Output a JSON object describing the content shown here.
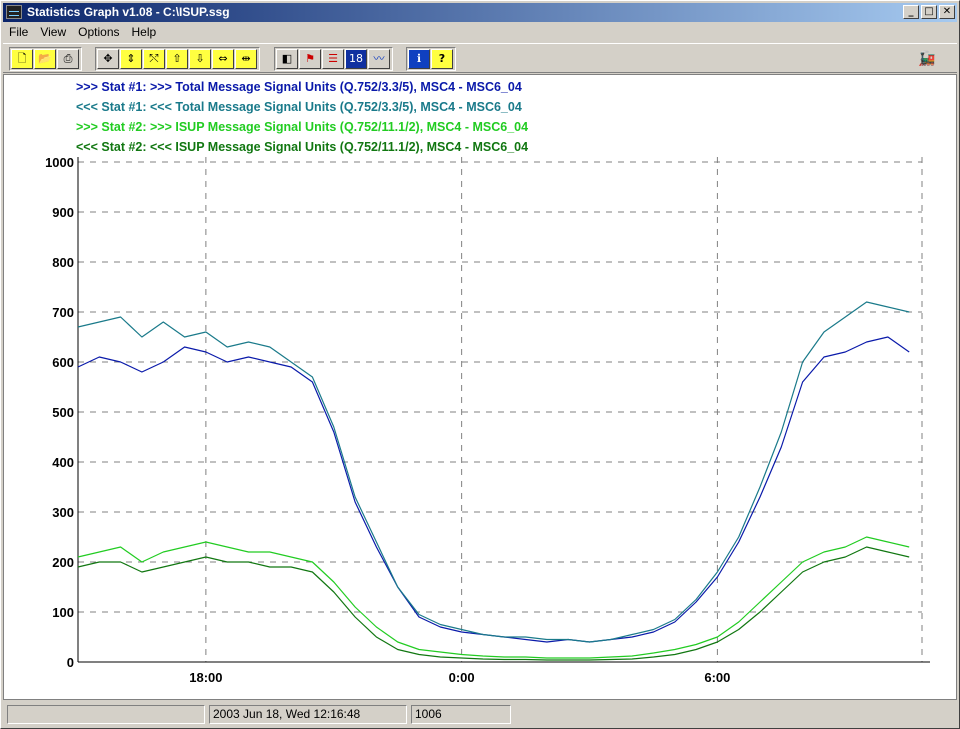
{
  "window": {
    "title": "Statistics Graph v1.08 - C:\\ISUP.ssg",
    "min_glyph": "_",
    "max_glyph": "□",
    "close_glyph": "✕"
  },
  "menu": [
    "File",
    "View",
    "Options",
    "Help"
  ],
  "toolbar": {
    "buttons": [
      {
        "name": "new-file",
        "icon": "new-file-icon",
        "glyph": "🗋"
      },
      {
        "name": "open-file",
        "icon": "open-folder-icon",
        "glyph": "📂"
      },
      {
        "name": "print",
        "icon": "printer-icon",
        "glyph": "⎙"
      },
      {
        "name": "zoom-all",
        "icon": "zoom-all-icon",
        "glyph": "✥"
      },
      {
        "name": "zoom-in-vertical",
        "icon": "expand-vertical-icon",
        "glyph": "⇕"
      },
      {
        "name": "zoom-out-vertical",
        "icon": "compress-vertical-icon",
        "glyph": "⤲"
      },
      {
        "name": "scroll-up",
        "icon": "arrow-up-icon",
        "glyph": "⇧"
      },
      {
        "name": "scroll-down",
        "icon": "arrow-down-icon",
        "glyph": "⇩"
      },
      {
        "name": "zoom-in-horizontal",
        "icon": "expand-horizontal-icon",
        "glyph": "⇔"
      },
      {
        "name": "zoom-out-horizontal",
        "icon": "compress-horizontal-icon",
        "glyph": "⇹"
      },
      {
        "name": "stat-selection",
        "icon": "half-square-icon",
        "glyph": "◧"
      },
      {
        "name": "alarm",
        "icon": "alarm-light-icon",
        "glyph": "⚑"
      },
      {
        "name": "stat-list",
        "icon": "list-icon",
        "glyph": "☰"
      },
      {
        "name": "calendar",
        "icon": "calendar-icon",
        "glyph": "18"
      },
      {
        "name": "graph-view",
        "icon": "line-graph-icon",
        "glyph": "〰"
      },
      {
        "name": "info",
        "icon": "info-icon",
        "glyph": "ℹ"
      },
      {
        "name": "help",
        "icon": "help-question-icon",
        "glyph": "?"
      }
    ],
    "status_icon": "train-icon",
    "status_glyph": "🚂"
  },
  "colors": {
    "stat1_out": "#0a1aaa",
    "stat1_in": "#1a7a8a",
    "stat2_out": "#22cc22",
    "stat2_in": "#117711",
    "grid": "#808080"
  },
  "chart_data": {
    "type": "line",
    "ylim": [
      0,
      1000
    ],
    "yticks": [
      0,
      100,
      200,
      300,
      400,
      500,
      600,
      700,
      800,
      900,
      1000
    ],
    "x_unit": "hours since 15:00, Jun 17",
    "xlim": [
      0,
      19.8
    ],
    "xticks": [
      {
        "at": 3,
        "label": "18:00"
      },
      {
        "at": 9,
        "label": "0:00"
      },
      {
        "at": 15,
        "label": "6:00"
      }
    ],
    "grid": true,
    "series": [
      {
        "name": ">>> Stat #1: >>> Total Message Signal Units (Q.752/3.3/5), MSC4 - MSC6_04",
        "color": "#0a1aaa",
        "x": [
          0,
          0.5,
          1,
          1.5,
          2,
          2.5,
          3,
          3.5,
          4,
          4.5,
          5,
          5.5,
          6,
          6.5,
          7,
          7.5,
          8,
          8.5,
          9,
          9.5,
          10,
          10.5,
          11,
          11.5,
          12,
          12.5,
          13,
          13.5,
          14,
          14.5,
          15,
          15.5,
          16,
          16.5,
          17,
          17.5,
          18,
          18.5,
          19,
          19.5
        ],
        "values": [
          590,
          610,
          600,
          580,
          600,
          630,
          620,
          600,
          610,
          600,
          590,
          560,
          460,
          320,
          230,
          150,
          90,
          70,
          60,
          55,
          50,
          45,
          40,
          45,
          40,
          45,
          50,
          60,
          80,
          120,
          170,
          240,
          330,
          430,
          560,
          610,
          620,
          640,
          650,
          620
        ]
      },
      {
        "name": "<<< Stat #1: <<< Total Message Signal Units (Q.752/3.3/5), MSC4 - MSC6_04",
        "color": "#1a7a8a",
        "x": [
          0,
          0.5,
          1,
          1.5,
          2,
          2.5,
          3,
          3.5,
          4,
          4.5,
          5,
          5.5,
          6,
          6.5,
          7,
          7.5,
          8,
          8.5,
          9,
          9.5,
          10,
          10.5,
          11,
          11.5,
          12,
          12.5,
          13,
          13.5,
          14,
          14.5,
          15,
          15.5,
          16,
          16.5,
          17,
          17.5,
          18,
          18.5,
          19,
          19.5
        ],
        "values": [
          670,
          680,
          690,
          650,
          680,
          650,
          660,
          630,
          640,
          630,
          600,
          570,
          470,
          330,
          240,
          150,
          95,
          75,
          65,
          55,
          50,
          50,
          45,
          45,
          40,
          45,
          55,
          65,
          85,
          125,
          180,
          250,
          350,
          460,
          600,
          660,
          690,
          720,
          710,
          700
        ]
      },
      {
        "name": ">>> Stat #2: >>> ISUP Message Signal Units (Q.752/11.1/2), MSC4 - MSC6_04",
        "color": "#22cc22",
        "x": [
          0,
          0.5,
          1,
          1.5,
          2,
          2.5,
          3,
          3.5,
          4,
          4.5,
          5,
          5.5,
          6,
          6.5,
          7,
          7.5,
          8,
          8.5,
          9,
          9.5,
          10,
          10.5,
          11,
          11.5,
          12,
          12.5,
          13,
          13.5,
          14,
          14.5,
          15,
          15.5,
          16,
          16.5,
          17,
          17.5,
          18,
          18.5,
          19,
          19.5
        ],
        "values": [
          210,
          220,
          230,
          200,
          220,
          230,
          240,
          230,
          220,
          220,
          210,
          200,
          160,
          110,
          70,
          40,
          25,
          20,
          15,
          12,
          10,
          10,
          8,
          8,
          8,
          10,
          12,
          18,
          25,
          35,
          50,
          80,
          120,
          160,
          200,
          220,
          230,
          250,
          240,
          230
        ]
      },
      {
        "name": "<<< Stat #2: <<< ISUP Message Signal Units (Q.752/11.1/2), MSC4 - MSC6_04",
        "color": "#117711",
        "x": [
          0,
          0.5,
          1,
          1.5,
          2,
          2.5,
          3,
          3.5,
          4,
          4.5,
          5,
          5.5,
          6,
          6.5,
          7,
          7.5,
          8,
          8.5,
          9,
          9.5,
          10,
          10.5,
          11,
          11.5,
          12,
          12.5,
          13,
          13.5,
          14,
          14.5,
          15,
          15.5,
          16,
          16.5,
          17,
          17.5,
          18,
          18.5,
          19,
          19.5
        ],
        "values": [
          190,
          200,
          200,
          180,
          190,
          200,
          210,
          200,
          200,
          190,
          190,
          180,
          140,
          90,
          50,
          25,
          15,
          10,
          8,
          6,
          5,
          5,
          4,
          4,
          4,
          5,
          6,
          10,
          15,
          25,
          40,
          65,
          100,
          140,
          180,
          200,
          210,
          230,
          220,
          210
        ]
      }
    ]
  },
  "status": {
    "left": "",
    "datetime": "2003 Jun 18, Wed 12:16:48",
    "count": "1006"
  }
}
